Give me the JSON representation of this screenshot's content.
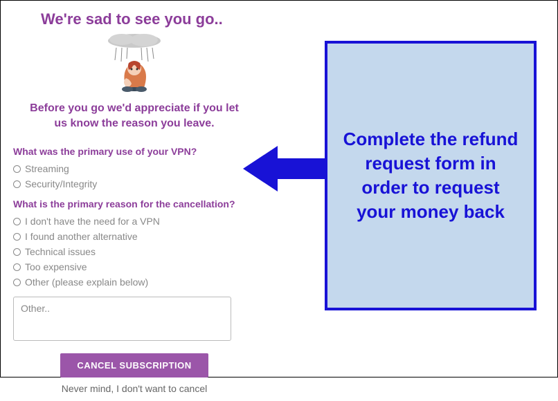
{
  "title": "We're sad to see you go..",
  "subtitle": "Before you go we'd appreciate if you let us know the reason you leave.",
  "question1": {
    "label": "What was the primary use of your VPN?",
    "options": [
      "Streaming",
      "Security/Integrity"
    ]
  },
  "question2": {
    "label": "What is the primary reason for the cancellation?",
    "options": [
      "I don't have the need for a VPN",
      "I found another alternative",
      "Technical issues",
      "Too expensive",
      "Other (please explain below)"
    ]
  },
  "otherPlaceholder": "Other..",
  "cancelButton": "CANCEL SUBSCRIPTION",
  "nevermind": "Never mind, I don't want to cancel",
  "callout": "Complete the refund request form in order to request your money back",
  "colors": {
    "brand": "#8c3d9a",
    "calloutBorder": "#1812d6",
    "calloutBg": "#c4d8ed"
  }
}
